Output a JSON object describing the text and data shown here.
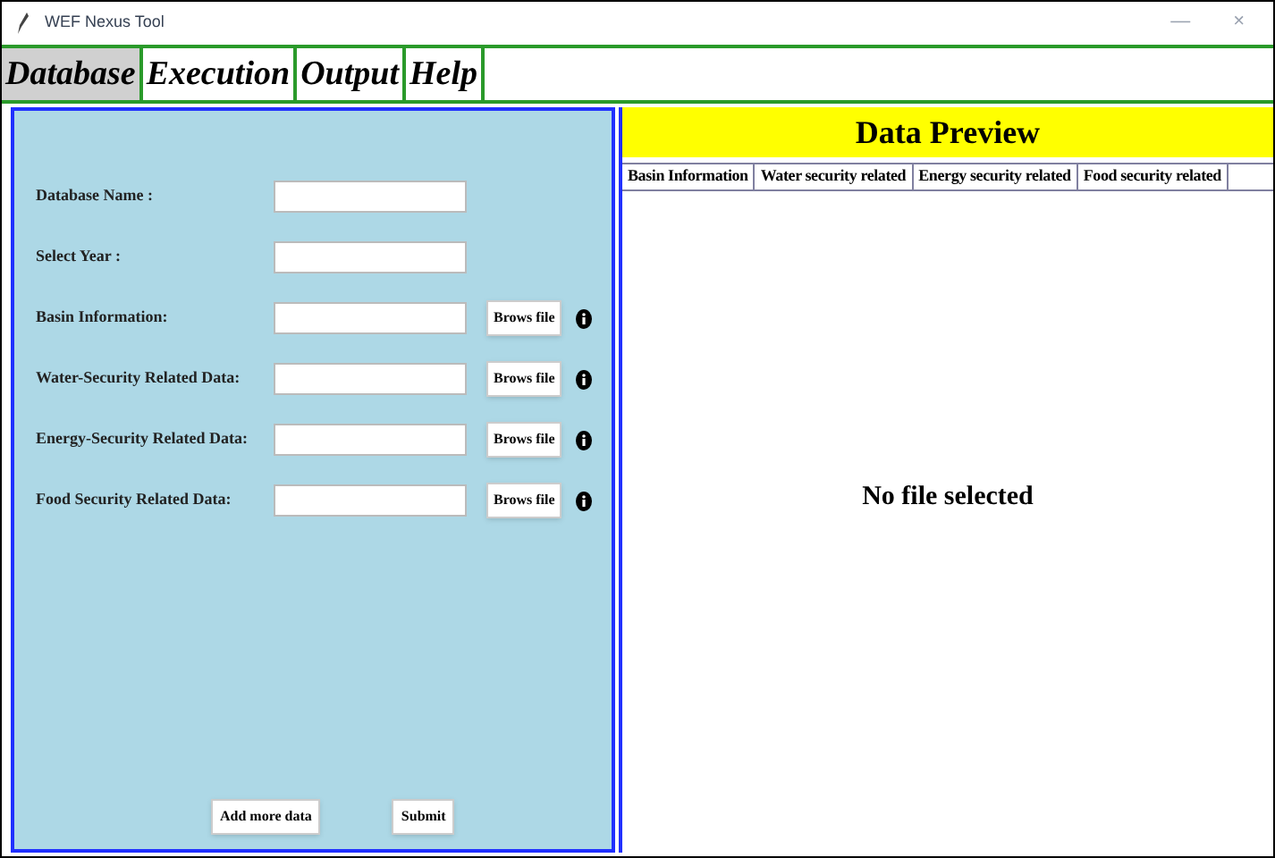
{
  "window": {
    "title": "WEF Nexus Tool",
    "controls": [
      "—",
      "×"
    ]
  },
  "menu": [
    {
      "label": "Database",
      "selected": true
    },
    {
      "label": "Execution",
      "selected": false
    },
    {
      "label": "Output",
      "selected": false
    },
    {
      "label": "Help",
      "selected": false
    }
  ],
  "form": {
    "fields": [
      {
        "label": "Database Name :",
        "kind": "text"
      },
      {
        "label": "Select Year :",
        "kind": "text"
      },
      {
        "label": "Basin Information:",
        "kind": "file",
        "button": "Brows file"
      },
      {
        "label": "Water-Security Related Data:",
        "kind": "file",
        "button": "Brows file"
      },
      {
        "label": "Energy-Security Related Data:",
        "kind": "file",
        "button": "Brows file"
      },
      {
        "label": "Food Security Related Data:",
        "kind": "file",
        "button": "Brows file"
      }
    ],
    "buttons": [
      "Add more data",
      "Submit"
    ]
  },
  "preview": {
    "title": "Data Preview",
    "columns": [
      "Basin Information",
      "Water security related",
      "Energy security related",
      "Food security related"
    ],
    "message": "No file selected"
  }
}
